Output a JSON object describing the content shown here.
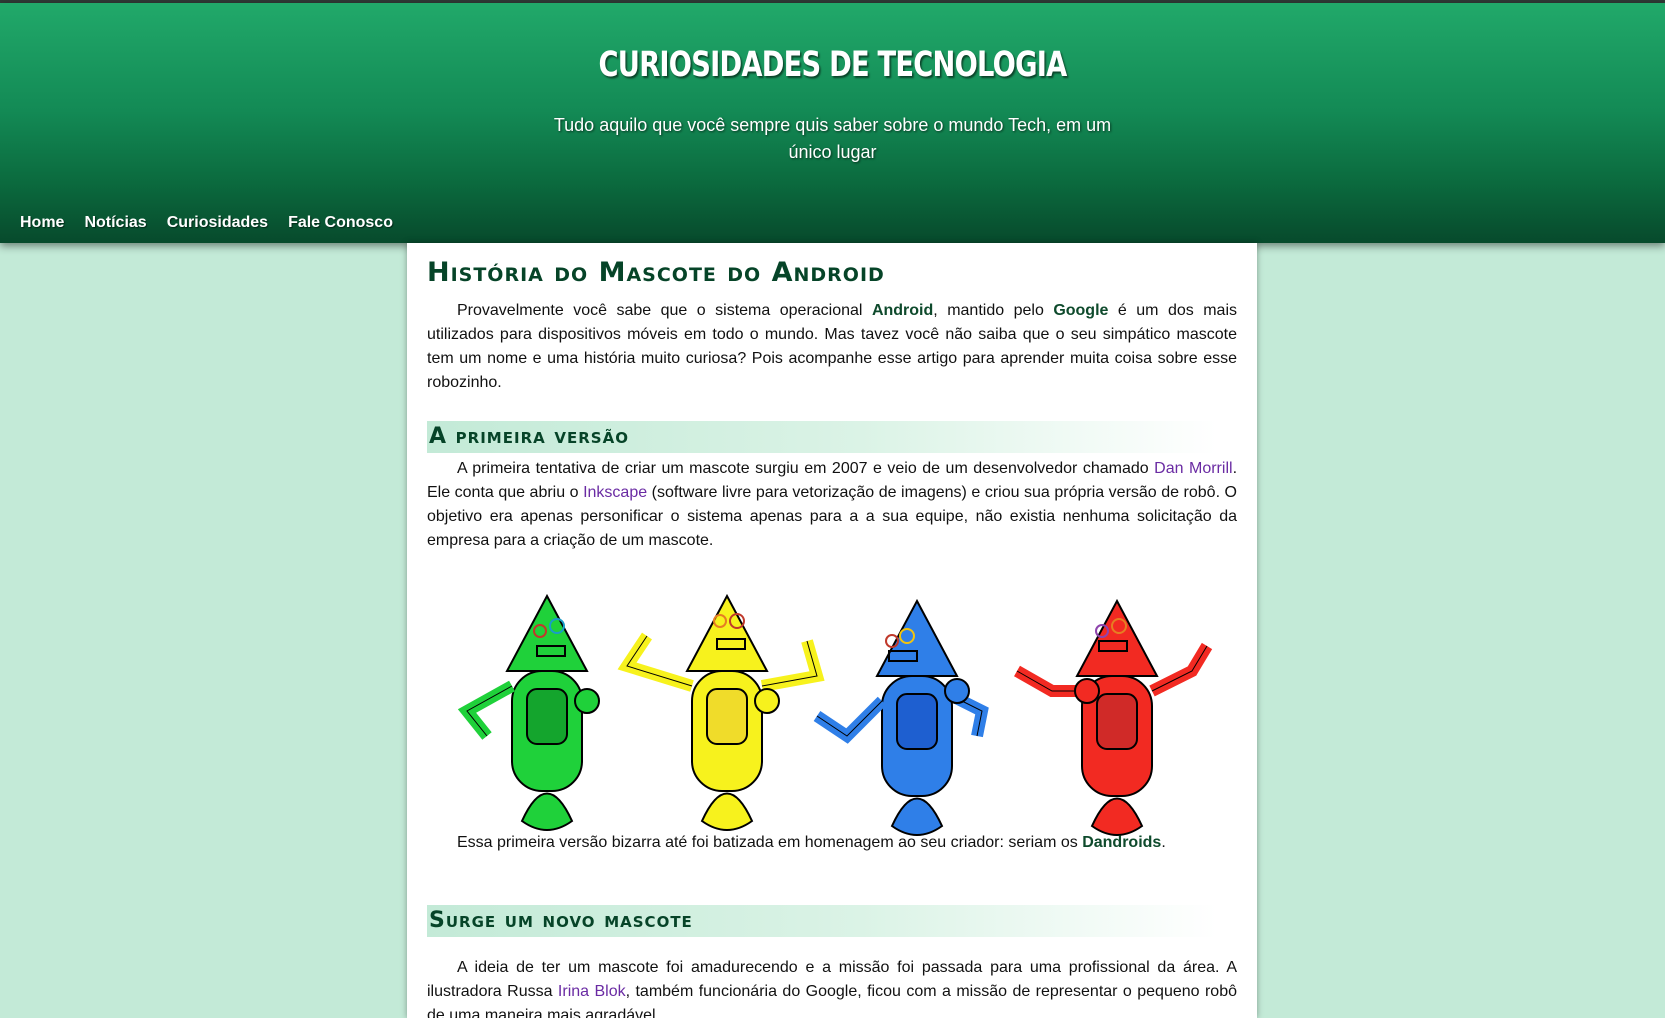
{
  "header": {
    "title": "CURIOSIDADES DE TECNOLOGIA",
    "subtitle": "Tudo aquilo que você sempre quis saber sobre o mundo Tech, em um único lugar"
  },
  "nav": {
    "items": [
      {
        "label": "Home"
      },
      {
        "label": "Notícias"
      },
      {
        "label": "Curiosidades"
      },
      {
        "label": "Fale Conosco"
      }
    ]
  },
  "article": {
    "title": "História do Mascote do Android",
    "intro": {
      "t1": "Provavelmente você sabe que o sistema operacional ",
      "android": "Android",
      "t2": ", mantido pelo ",
      "google": "Google",
      "t3": " é um dos mais utilizados para dispositivos móveis em todo o mundo. Mas tavez você não saiba que o seu simpático mascote tem um nome e uma história muito curiosa? Pois acompanhe esse artigo para aprender muita coisa sobre esse robozinho."
    },
    "section1": {
      "heading": "A primeira versão",
      "p1": {
        "t1": "A primeira tentativa de criar um mascote surgiu em 2007 e veio de um desenvolvedor chamado ",
        "link1": "Dan Morrill",
        "t2": ". Ele conta que abriu o ",
        "link2": "Inkscape",
        "t3": " (software livre para vetorização de imagens) e criou sua própria versão de robô. O objetivo era apenas personificar o sistema apenas para a a sua equipe, não existia nenhuma solicitação da empresa para a criação de um mascote."
      },
      "robot_colors": [
        "#1fd13a",
        "#f7f21d",
        "#2f7fe8",
        "#f22a22"
      ],
      "p2": {
        "t1": "Essa primeira versão bizarra até foi batizada em homenagem ao seu criador: seriam os ",
        "bold": "Dandroids",
        "t2": "."
      }
    },
    "section2": {
      "heading": "Surge um novo mascote",
      "p1": {
        "t1": "A ideia de ter um mascote foi amadurecendo e a missão foi passada para uma profissional da área. A ilustradora Russa ",
        "link": "Irina Blok",
        "t2": ", também funcionária do Google, ficou com a missão de representar o pequeno robô de uma maneira mais agradável."
      }
    }
  }
}
